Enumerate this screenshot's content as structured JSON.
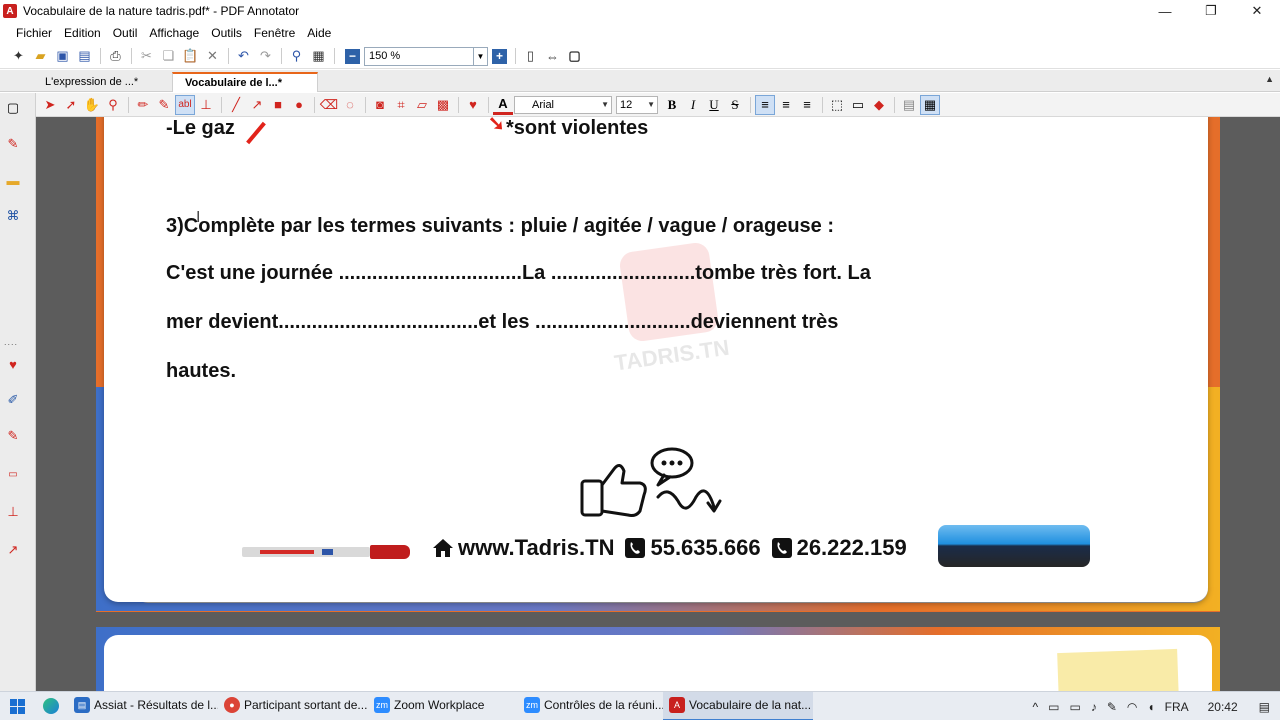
{
  "window": {
    "title": "Vocabulaire de la nature tadris.pdf* - PDF Annotator",
    "minimize": "—",
    "restore": "❐",
    "close": "✕"
  },
  "menu": [
    "Fichier",
    "Edition",
    "Outil",
    "Affichage",
    "Outils",
    "Fenêtre",
    "Aide"
  ],
  "toolbar": {
    "zoom_value": "150 %"
  },
  "tabs": [
    {
      "label": "L'expression de ...*"
    },
    {
      "label": "Vocabulaire de l...*"
    }
  ],
  "annot_toolbar": {
    "font_name": "Arial",
    "font_size": "12",
    "bold": "B",
    "italic": "I",
    "underline": "U",
    "strike": "S"
  },
  "document": {
    "line_gas": "-Le gaz",
    "line_violentes": "*sont violentes",
    "exercise_title": "3)Complète par les termes suivants : pluie / agitée / vague / orageuse :",
    "line1": "C'est une journée .................................La ..........................tombe très fort. La",
    "line2": "mer devient....................................et les ............................deviennent très",
    "line3": "hautes.",
    "footer_site": "www.Tadris.TN",
    "footer_phone1": "55.635.666",
    "footer_phone2": "26.222.159",
    "watermark": "TADRIS.TN"
  },
  "taskbar": {
    "items": [
      {
        "label": "Assiat - Résultats de l...",
        "color": "#2b6cc4"
      },
      {
        "label": "Participant sortant de...",
        "color": "#db4437"
      },
      {
        "label": "Zoom Workplace",
        "color": "#2d8cff"
      },
      {
        "label": "Contrôles de la réuni...",
        "color": "#2d8cff"
      },
      {
        "label": "Vocabulaire de la nat...",
        "color": "#c8201e"
      }
    ],
    "language": "FRA",
    "time": "20:42"
  },
  "colors": {
    "accent": "#e8661a",
    "annotation_red": "#e2231a"
  }
}
